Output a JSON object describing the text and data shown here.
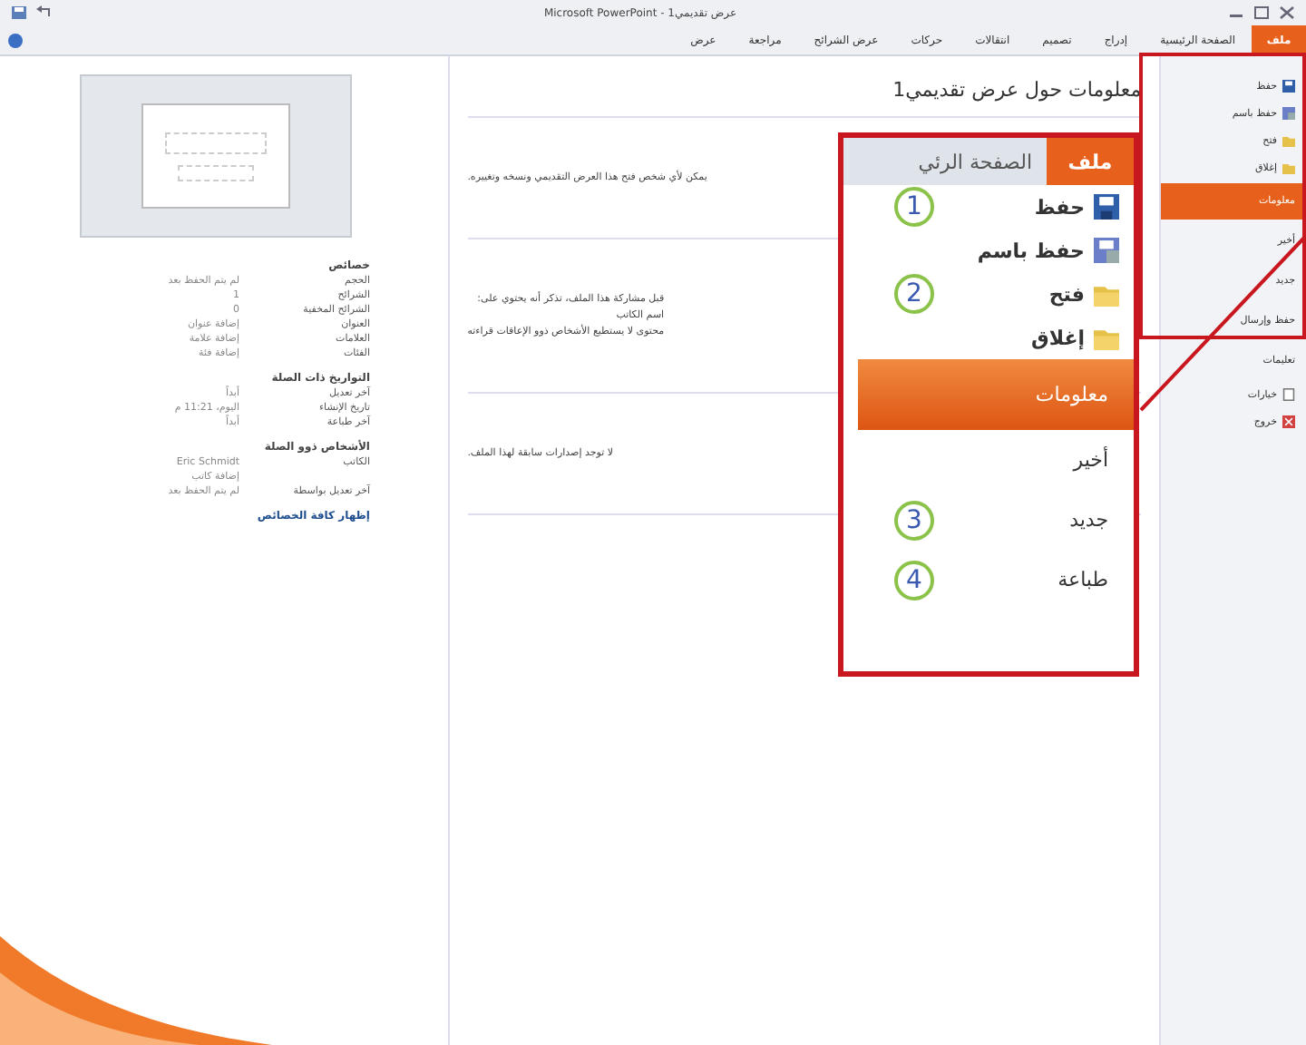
{
  "window": {
    "title": "Microsoft PowerPoint - عرض تقديمي1"
  },
  "ribbon_tabs": [
    {
      "label": "ملف",
      "selected": true
    },
    {
      "label": "الصفحة الرئيسية",
      "selected": false
    },
    {
      "label": "إدراج",
      "selected": false
    },
    {
      "label": "تصميم",
      "selected": false
    },
    {
      "label": "انتقالات",
      "selected": false
    },
    {
      "label": "حركات",
      "selected": false
    },
    {
      "label": "عرض الشرائح",
      "selected": false
    },
    {
      "label": "مراجعة",
      "selected": false
    },
    {
      "label": "عرض",
      "selected": false
    }
  ],
  "backstage_menu": [
    {
      "label": "حفظ",
      "kind": "save",
      "selected": false
    },
    {
      "label": "حفظ باسم",
      "kind": "save-as",
      "selected": false
    },
    {
      "label": "فتح",
      "kind": "folder",
      "selected": false
    },
    {
      "label": "إغلاق",
      "kind": "folder",
      "selected": false
    },
    {
      "label": "معلومات",
      "kind": "page",
      "selected": true
    },
    {
      "label": "أخير",
      "kind": "page",
      "selected": false
    },
    {
      "label": "جديد",
      "kind": "page",
      "selected": false
    },
    {
      "label": "حفظ وإرسال",
      "kind": "page",
      "selected": false
    },
    {
      "label": "تعليمات",
      "kind": "page",
      "selected": false
    },
    {
      "label": "خيارات",
      "kind": "options",
      "selected": false
    },
    {
      "label": "خروج",
      "kind": "exit",
      "selected": false
    }
  ],
  "info": {
    "heading": "معلومات حول عرض تقديمي1",
    "sections": [
      {
        "lines": [
          "يمكن لأي شخص فتح هذا العرض التقديمي ونسخه وتغييره."
        ]
      },
      {
        "lines": [
          "قبل مشاركة هذا الملف، تذكر أنه يحتوي على:",
          "اسم الكاتب",
          "محتوى لا يستطيع الأشخاص ذوو الإعاقات قراءته"
        ]
      },
      {
        "lines": [
          "لا توجد إصدارات سابقة لهذا الملف."
        ]
      }
    ]
  },
  "properties": {
    "groups": [
      {
        "heading": "خصائص",
        "rows": [
          {
            "label": "الحجم",
            "value": "لم يتم الحفظ بعد"
          },
          {
            "label": "الشرائح",
            "value": "1"
          },
          {
            "label": "الشرائح المخفية",
            "value": "0"
          },
          {
            "label": "العنوان",
            "value": "إضافة عنوان"
          },
          {
            "label": "العلامات",
            "value": "إضافة علامة"
          },
          {
            "label": "الفئات",
            "value": "إضافة فئة"
          }
        ]
      },
      {
        "heading": "التواريخ ذات الصلة",
        "rows": [
          {
            "label": "آخر تعديل",
            "value": "أبداً"
          },
          {
            "label": "تاريخ الإنشاء",
            "value": "اليوم، 11:21 م"
          },
          {
            "label": "آخر طباعة",
            "value": "أبداً"
          }
        ]
      },
      {
        "heading": "الأشخاص ذوو الصلة",
        "rows": [
          {
            "label": "الكاتب",
            "value": "Eric Schmidt"
          },
          {
            "label": "",
            "value": "إضافة كاتب"
          },
          {
            "label": "آخر تعديل بواسطة",
            "value": "لم يتم الحفظ بعد"
          }
        ]
      }
    ],
    "link": "إظهار كافة الخصائص"
  },
  "callout": {
    "tabs": [
      {
        "label": "ملف",
        "selected": true
      },
      {
        "label": "الصفحة الرئي",
        "selected": false
      }
    ],
    "items": [
      {
        "label": "حفظ",
        "kind": "save",
        "selected": false,
        "number": "1"
      },
      {
        "label": "حفظ باسم",
        "kind": "save-as",
        "selected": false
      },
      {
        "label": "فتح",
        "kind": "folder",
        "selected": false,
        "number": "2"
      },
      {
        "label": "إغلاق",
        "kind": "folder",
        "selected": false
      },
      {
        "label": "معلومات",
        "kind": "page",
        "selected": true
      },
      {
        "label": "أخير",
        "kind": "page",
        "selected": false
      },
      {
        "label": "جديد",
        "kind": "page",
        "selected": false,
        "number": "3"
      },
      {
        "label": "طباعة",
        "kind": "page",
        "selected": false,
        "number": "4"
      }
    ]
  }
}
